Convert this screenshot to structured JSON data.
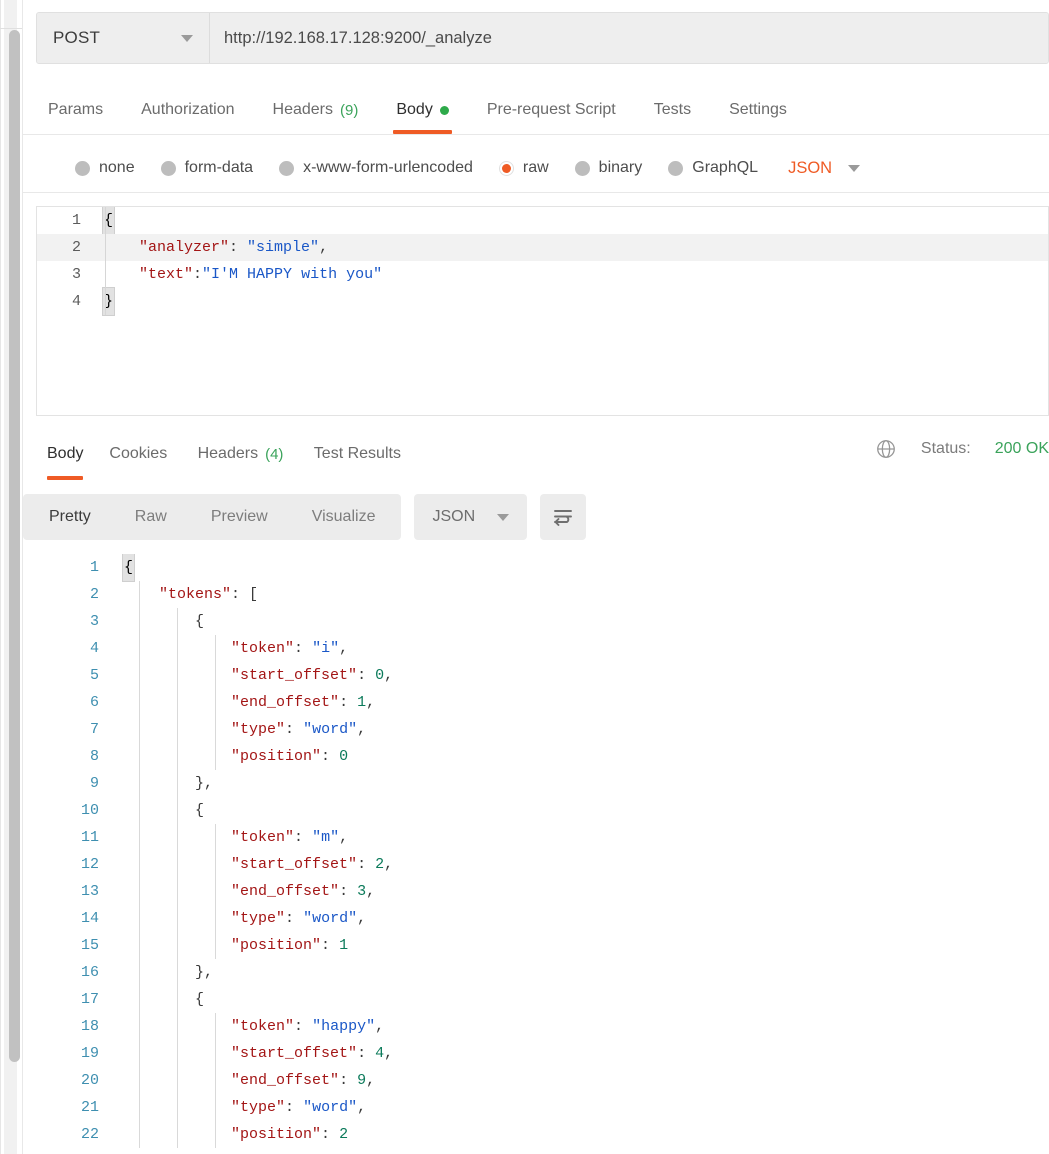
{
  "request": {
    "method": "POST",
    "url": "http://192.168.17.128:9200/_analyze",
    "tabs": [
      {
        "label": "Params",
        "active": false,
        "count": null,
        "dot": false
      },
      {
        "label": "Authorization",
        "active": false,
        "count": null,
        "dot": false
      },
      {
        "label": "Headers",
        "active": false,
        "count": "(9)",
        "dot": false
      },
      {
        "label": "Body",
        "active": true,
        "count": null,
        "dot": true
      },
      {
        "label": "Pre-request Script",
        "active": false,
        "count": null,
        "dot": false
      },
      {
        "label": "Tests",
        "active": false,
        "count": null,
        "dot": false
      },
      {
        "label": "Settings",
        "active": false,
        "count": null,
        "dot": false
      }
    ],
    "body_types": [
      {
        "label": "none",
        "selected": false
      },
      {
        "label": "form-data",
        "selected": false
      },
      {
        "label": "x-www-form-urlencoded",
        "selected": false
      },
      {
        "label": "raw",
        "selected": true
      },
      {
        "label": "binary",
        "selected": false
      },
      {
        "label": "GraphQL",
        "selected": false
      }
    ],
    "body_format": "JSON",
    "body_lines": [
      {
        "num": "1",
        "segments": [
          {
            "t": "{",
            "c": "brace"
          }
        ],
        "highlight": false
      },
      {
        "num": "2",
        "segments": [
          {
            "t": "    ",
            "c": "p"
          },
          {
            "t": "\"analyzer\"",
            "c": "k"
          },
          {
            "t": ": ",
            "c": "p"
          },
          {
            "t": "\"simple\"",
            "c": "s"
          },
          {
            "t": ",",
            "c": "p"
          }
        ],
        "highlight": true
      },
      {
        "num": "3",
        "segments": [
          {
            "t": "    ",
            "c": "p"
          },
          {
            "t": "\"text\"",
            "c": "k"
          },
          {
            "t": ":",
            "c": "p"
          },
          {
            "t": "\"I'M HAPPY with you\"",
            "c": "s"
          }
        ],
        "highlight": false
      },
      {
        "num": "4",
        "segments": [
          {
            "t": "}",
            "c": "brace"
          }
        ],
        "highlight": false
      }
    ]
  },
  "response": {
    "tabs": [
      {
        "label": "Body",
        "active": true,
        "count": null
      },
      {
        "label": "Cookies",
        "active": false,
        "count": null
      },
      {
        "label": "Headers",
        "active": false,
        "count": "(4)"
      },
      {
        "label": "Test Results",
        "active": false,
        "count": null
      }
    ],
    "status_label": "Status:",
    "status_value": "200 OK",
    "view_modes": [
      {
        "label": "Pretty",
        "active": true
      },
      {
        "label": "Raw",
        "active": false
      },
      {
        "label": "Preview",
        "active": false
      },
      {
        "label": "Visualize",
        "active": false
      }
    ],
    "format": "JSON",
    "body_lines": [
      {
        "num": "1",
        "indent": 0,
        "segments": [
          {
            "t": "{",
            "c": "brace"
          }
        ]
      },
      {
        "num": "2",
        "indent": 1,
        "segments": [
          {
            "t": "    ",
            "c": "p"
          },
          {
            "t": "\"tokens\"",
            "c": "k"
          },
          {
            "t": ": [",
            "c": "p"
          }
        ]
      },
      {
        "num": "3",
        "indent": 2,
        "segments": [
          {
            "t": "        {",
            "c": "p"
          }
        ]
      },
      {
        "num": "4",
        "indent": 3,
        "segments": [
          {
            "t": "            ",
            "c": "p"
          },
          {
            "t": "\"token\"",
            "c": "k"
          },
          {
            "t": ": ",
            "c": "p"
          },
          {
            "t": "\"i\"",
            "c": "s"
          },
          {
            "t": ",",
            "c": "p"
          }
        ]
      },
      {
        "num": "5",
        "indent": 3,
        "segments": [
          {
            "t": "            ",
            "c": "p"
          },
          {
            "t": "\"start_offset\"",
            "c": "k"
          },
          {
            "t": ": ",
            "c": "p"
          },
          {
            "t": "0",
            "c": "n"
          },
          {
            "t": ",",
            "c": "p"
          }
        ]
      },
      {
        "num": "6",
        "indent": 3,
        "segments": [
          {
            "t": "            ",
            "c": "p"
          },
          {
            "t": "\"end_offset\"",
            "c": "k"
          },
          {
            "t": ": ",
            "c": "p"
          },
          {
            "t": "1",
            "c": "n"
          },
          {
            "t": ",",
            "c": "p"
          }
        ]
      },
      {
        "num": "7",
        "indent": 3,
        "segments": [
          {
            "t": "            ",
            "c": "p"
          },
          {
            "t": "\"type\"",
            "c": "k"
          },
          {
            "t": ": ",
            "c": "p"
          },
          {
            "t": "\"word\"",
            "c": "s"
          },
          {
            "t": ",",
            "c": "p"
          }
        ]
      },
      {
        "num": "8",
        "indent": 3,
        "segments": [
          {
            "t": "            ",
            "c": "p"
          },
          {
            "t": "\"position\"",
            "c": "k"
          },
          {
            "t": ": ",
            "c": "p"
          },
          {
            "t": "0",
            "c": "n"
          }
        ]
      },
      {
        "num": "9",
        "indent": 2,
        "segments": [
          {
            "t": "        },",
            "c": "p"
          }
        ]
      },
      {
        "num": "10",
        "indent": 2,
        "segments": [
          {
            "t": "        {",
            "c": "p"
          }
        ]
      },
      {
        "num": "11",
        "indent": 3,
        "segments": [
          {
            "t": "            ",
            "c": "p"
          },
          {
            "t": "\"token\"",
            "c": "k"
          },
          {
            "t": ": ",
            "c": "p"
          },
          {
            "t": "\"m\"",
            "c": "s"
          },
          {
            "t": ",",
            "c": "p"
          }
        ]
      },
      {
        "num": "12",
        "indent": 3,
        "segments": [
          {
            "t": "            ",
            "c": "p"
          },
          {
            "t": "\"start_offset\"",
            "c": "k"
          },
          {
            "t": ": ",
            "c": "p"
          },
          {
            "t": "2",
            "c": "n"
          },
          {
            "t": ",",
            "c": "p"
          }
        ]
      },
      {
        "num": "13",
        "indent": 3,
        "segments": [
          {
            "t": "            ",
            "c": "p"
          },
          {
            "t": "\"end_offset\"",
            "c": "k"
          },
          {
            "t": ": ",
            "c": "p"
          },
          {
            "t": "3",
            "c": "n"
          },
          {
            "t": ",",
            "c": "p"
          }
        ]
      },
      {
        "num": "14",
        "indent": 3,
        "segments": [
          {
            "t": "            ",
            "c": "p"
          },
          {
            "t": "\"type\"",
            "c": "k"
          },
          {
            "t": ": ",
            "c": "p"
          },
          {
            "t": "\"word\"",
            "c": "s"
          },
          {
            "t": ",",
            "c": "p"
          }
        ]
      },
      {
        "num": "15",
        "indent": 3,
        "segments": [
          {
            "t": "            ",
            "c": "p"
          },
          {
            "t": "\"position\"",
            "c": "k"
          },
          {
            "t": ": ",
            "c": "p"
          },
          {
            "t": "1",
            "c": "n"
          }
        ]
      },
      {
        "num": "16",
        "indent": 2,
        "segments": [
          {
            "t": "        },",
            "c": "p"
          }
        ]
      },
      {
        "num": "17",
        "indent": 2,
        "segments": [
          {
            "t": "        {",
            "c": "p"
          }
        ]
      },
      {
        "num": "18",
        "indent": 3,
        "segments": [
          {
            "t": "            ",
            "c": "p"
          },
          {
            "t": "\"token\"",
            "c": "k"
          },
          {
            "t": ": ",
            "c": "p"
          },
          {
            "t": "\"happy\"",
            "c": "s"
          },
          {
            "t": ",",
            "c": "p"
          }
        ]
      },
      {
        "num": "19",
        "indent": 3,
        "segments": [
          {
            "t": "            ",
            "c": "p"
          },
          {
            "t": "\"start_offset\"",
            "c": "k"
          },
          {
            "t": ": ",
            "c": "p"
          },
          {
            "t": "4",
            "c": "n"
          },
          {
            "t": ",",
            "c": "p"
          }
        ]
      },
      {
        "num": "20",
        "indent": 3,
        "segments": [
          {
            "t": "            ",
            "c": "p"
          },
          {
            "t": "\"end_offset\"",
            "c": "k"
          },
          {
            "t": ": ",
            "c": "p"
          },
          {
            "t": "9",
            "c": "n"
          },
          {
            "t": ",",
            "c": "p"
          }
        ]
      },
      {
        "num": "21",
        "indent": 3,
        "segments": [
          {
            "t": "            ",
            "c": "p"
          },
          {
            "t": "\"type\"",
            "c": "k"
          },
          {
            "t": ": ",
            "c": "p"
          },
          {
            "t": "\"word\"",
            "c": "s"
          },
          {
            "t": ",",
            "c": "p"
          }
        ]
      },
      {
        "num": "22",
        "indent": 3,
        "segments": [
          {
            "t": "            ",
            "c": "p"
          },
          {
            "t": "\"position\"",
            "c": "k"
          },
          {
            "t": ": ",
            "c": "p"
          },
          {
            "t": "2",
            "c": "n"
          }
        ]
      }
    ]
  }
}
